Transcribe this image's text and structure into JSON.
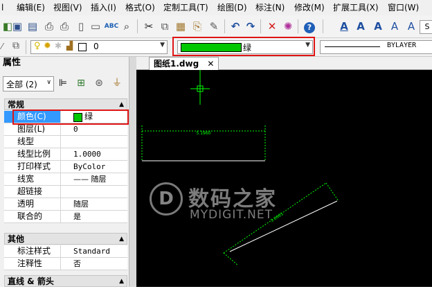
{
  "menubar": {
    "items": [
      "编辑(E)",
      "视图(V)",
      "插入(I)",
      "格式(O)",
      "定制工具(T)",
      "绘图(D)",
      "标注(N)",
      "修改(M)",
      "扩展工具(X)",
      "窗口(W)"
    ]
  },
  "toolbar": {
    "icons": [
      "save-icon",
      "save-as-icon",
      "print-icon",
      "print-preview-icon",
      "preview-icon",
      "publish-icon",
      "spellcheck-icon",
      "find-icon",
      "cut-icon",
      "copy-icon",
      "paste-icon",
      "match-properties-icon",
      "paint-brush-icon",
      "undo-icon",
      "redo-icon",
      "delete-icon",
      "erase-icon",
      "help-icon",
      "text-style-icon",
      "text-icon",
      "text-edit-icon",
      "text-check-icon",
      "text-find-icon"
    ]
  },
  "properties_toolbar": {
    "layer_value": "0",
    "color_label": "绿",
    "color_hex": "#00c800",
    "linetype_label": "BYLAYER"
  },
  "palette": {
    "title": "属性",
    "selection": "全部 (2)",
    "sections": {
      "general": "常规",
      "other": "其他",
      "lines_arrows": "直线 & 箭头"
    },
    "general_rows": [
      {
        "key": "颜色(C)",
        "value": "绿"
      },
      {
        "key": "图层(L)",
        "value": "0"
      },
      {
        "key": "线型",
        "value": ""
      },
      {
        "key": "线型比例",
        "value": "1.0000"
      },
      {
        "key": "打印样式",
        "value": "ByColor"
      },
      {
        "key": "线宽",
        "value": "—— 随层"
      },
      {
        "key": "超链接",
        "value": ""
      },
      {
        "key": "透明",
        "value": "随层"
      },
      {
        "key": "联合的",
        "value": "是"
      }
    ],
    "other_rows": [
      {
        "key": "标注样式",
        "value": "Standard"
      },
      {
        "key": "注释性",
        "value": "否"
      }
    ]
  },
  "drawing": {
    "tab_label": "图纸1.dwg",
    "dim1_text": "5.1960",
    "dim2_text": "3.0001",
    "drawing_color": "#00ff00"
  },
  "watermark": {
    "cn": "数码之家",
    "en": "MYDIGIT.NET"
  }
}
